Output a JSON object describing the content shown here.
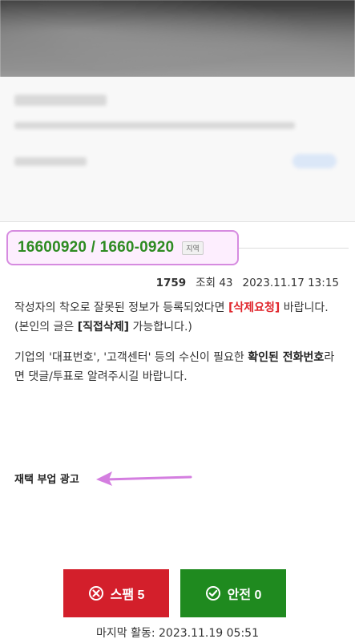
{
  "phone": {
    "number": "16600920  /  1660-0920",
    "region_badge": "지역"
  },
  "meta": {
    "post_id": "1759",
    "views_label": "조회",
    "views": "43",
    "date": "2023.11.17 13:15"
  },
  "notice1": {
    "before": "작성자의 착오로 잘못된 정보가 등록되었다면 ",
    "delete_request": "[삭제요청]",
    "middle": " 바랍니다. (본인의 글은 ",
    "direct_delete": "[직접삭제]",
    "after": " 가능합니다.)"
  },
  "notice2": {
    "before": "기업의 '대표번호', '고객센터' 등의 수신이 필요한 ",
    "bold": "확인된 전화번호",
    "after": "라면 댓글/투표로 알려주시길 바랍니다."
  },
  "ad_label": "재택 부업 광고",
  "buttons": {
    "spam_label": "스팸 5",
    "safe_label": "안전 0"
  },
  "last_activity": "마지막 활동: 2023.11.19 05:51",
  "colors": {
    "spam": "#d31f2b",
    "safe": "#1f8a1f",
    "highlight_border": "#d68be0",
    "phone_text": "#2e8b22"
  }
}
